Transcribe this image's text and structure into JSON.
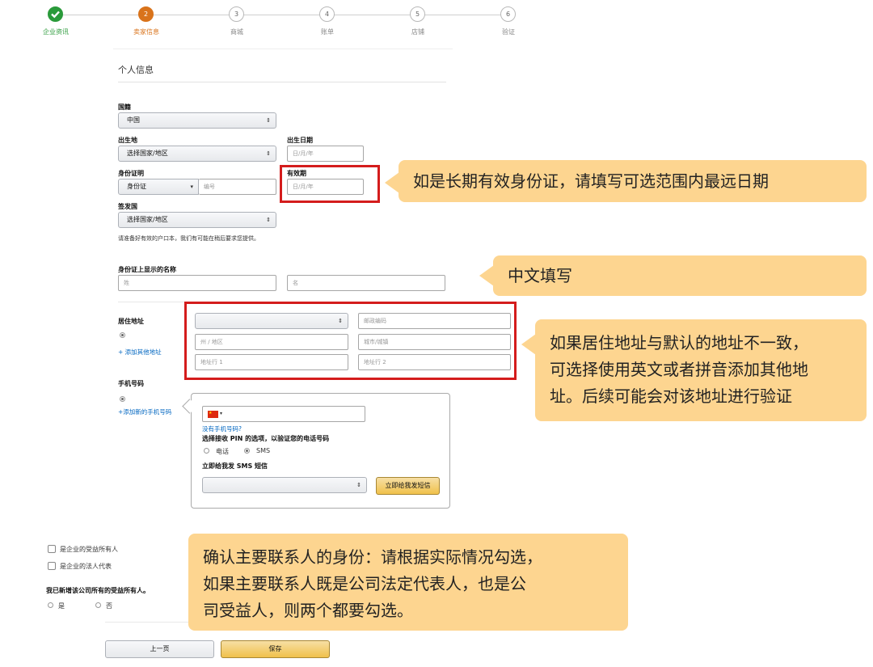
{
  "stepper": {
    "steps": [
      {
        "label": "企业资讯",
        "number": ""
      },
      {
        "label": "卖家信息",
        "number": "2"
      },
      {
        "label": "商城",
        "number": "3"
      },
      {
        "label": "账单",
        "number": "4"
      },
      {
        "label": "店铺",
        "number": "5"
      },
      {
        "label": "验证",
        "number": "6"
      }
    ],
    "colors": {
      "done": "#2a9a3a",
      "active": "#d9731b"
    }
  },
  "form": {
    "section_title": "个人信息",
    "nationality": {
      "label": "国籍",
      "value": "中国"
    },
    "birthplace": {
      "label": "出生地",
      "value": "选择国家/地区"
    },
    "birthdate": {
      "label": "出生日期",
      "placeholder": "日/月/年"
    },
    "id_proof": {
      "label": "身份证明",
      "type_value": "身份证",
      "number_placeholder": "编号"
    },
    "expiry": {
      "label": "有效期",
      "placeholder": "日/月/年"
    },
    "issuing_country": {
      "label": "签发国",
      "value": "选择国家/地区"
    },
    "note": "请准备好有效的户口本，我们有可能在稍后要求您提供。",
    "name_on_id": {
      "label": "身份证上显示的名称",
      "last_placeholder": "姓",
      "first_placeholder": "名"
    },
    "address": {
      "label": "居住地址",
      "add_link": "+ 添加其他地址",
      "country_value": "",
      "postcode_placeholder": "邮政编码",
      "state_placeholder": "州 / 地区",
      "city_placeholder": "城市/城镇",
      "line1_placeholder": "地址行 1",
      "line2_placeholder": "地址行 2"
    },
    "phone": {
      "label": "手机号码",
      "add_link": "+添加新的手机号码",
      "no_phone_link": "没有手机号码?",
      "pin_label": "选择接收 PIN 的选项，以验证您的电话号码",
      "option_call": "电话",
      "option_sms": "SMS",
      "send_label": "立即给我发 SMS 短信",
      "send_button": "立即给我发短信"
    },
    "checkbox_owner": "是企业的受益所有人",
    "checkbox_legal": "是企业的法人代表",
    "added_all_question": "我已新增该公司所有的受益所有人。",
    "yes": "是",
    "no": "否",
    "prev_button": "上一页",
    "save_button": "保存"
  },
  "callouts": {
    "expiry": "如是长期有效身份证，请填写可选范围内最远日期",
    "chinese": "中文填写",
    "address_lines": [
      "如果居住地址与默认的地址不一致，",
      "可选择使用英文或者拼音添加其他地",
      "址。后续可能会对该地址进行验证"
    ],
    "contact_lines": [
      "确认主要联系人的身份：请根据实际情况勾选，",
      "如果主要联系人既是公司法定代表人，也是公",
      "司受益人，则两个都要勾选。"
    ]
  },
  "colors": {
    "highlight_border": "#d41c1c",
    "callout_bg": "#fdd590",
    "save_button": "#f0c14b",
    "link": "#0066c0"
  }
}
